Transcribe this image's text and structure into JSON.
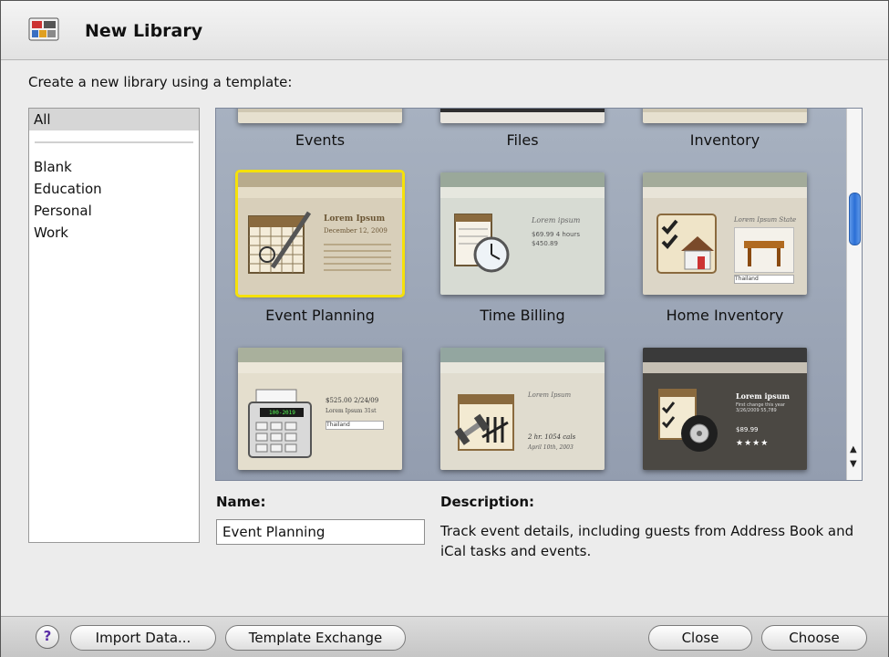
{
  "window": {
    "title": "New Library"
  },
  "prompt": "Create a new library using a template:",
  "categories": {
    "all": "All",
    "items": [
      "Blank",
      "Education",
      "Personal",
      "Work"
    ]
  },
  "templates": {
    "row1": [
      "Events",
      "Files",
      "Inventory"
    ],
    "row2": [
      "Event Planning",
      "Time Billing",
      "Home Inventory"
    ],
    "selected": "Event Planning"
  },
  "previews": {
    "event_planning": {
      "title": "Lorem Ipsum",
      "date": "December 12, 2009"
    },
    "time_billing": {
      "title": "Lorem ipsum",
      "amount": "$69.99  4 hours",
      "total": "$450.89"
    },
    "home_inventory": {
      "title": "Lorem Ipsum State",
      "select": "Thailand"
    },
    "budget": {
      "line": "$525.00  2/24/09",
      "sub": "Lorem Ipsum 31st",
      "select": "Thailand",
      "calc": "100-2019"
    },
    "exercise": {
      "title": "Lorem Ipsum",
      "stat": "2 hr. 1054 cals",
      "date": "April 10th, 2003"
    },
    "vehicle": {
      "title": "Lorem ipsum",
      "line": "First change this year 3/26/2009  55,789",
      "price": "$89.99",
      "stars": "★★★★"
    }
  },
  "form": {
    "name_label": "Name:",
    "name_value": "Event Planning",
    "description_label": "Description:",
    "description": "Track event details, including guests from Address Book and iCal tasks and events."
  },
  "buttons": {
    "help": "?",
    "import": "Import Data...",
    "exchange": "Template Exchange",
    "close": "Close",
    "choose": "Choose"
  },
  "colors": {
    "selection": "#f5e10a",
    "scroll_thumb": "#2b6fd6",
    "gallery_bg": "#9ea8b8"
  }
}
